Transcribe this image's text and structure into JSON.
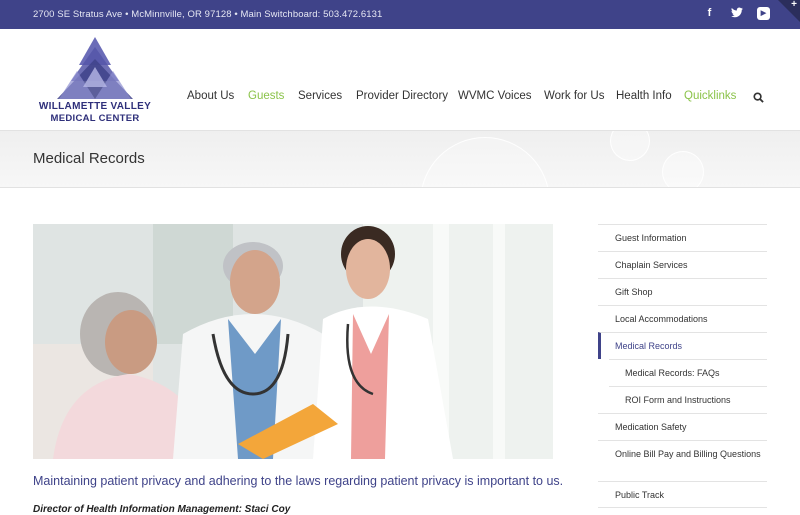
{
  "topbar": {
    "address": "2700 SE Stratus Ave • McMinnville, OR 97128 • Main Switchboard: 503.472.6131",
    "social": [
      "facebook-icon",
      "twitter-icon",
      "youtube-icon"
    ]
  },
  "logo": {
    "line1": "WILLAMETTE VALLEY",
    "line2": "MEDICAL CENTER"
  },
  "nav": {
    "items": [
      "About Us",
      "Guests",
      "Services",
      "Provider Directory",
      "WVMC Voices",
      "Work for Us",
      "Health Info",
      "Quicklinks"
    ]
  },
  "page": {
    "title": "Medical Records",
    "intro": "Maintaining patient privacy and adhering to the laws regarding patient privacy is important to us.",
    "director": "Director of Health Information Management: Staci Coy"
  },
  "sidebar": {
    "items": [
      "Guest Information",
      "Chaplain Services",
      "Gift Shop",
      "Local Accommodations",
      "Medical Records",
      "Medical Records: FAQs",
      "ROI Form and Instructions",
      "Medication Safety",
      "Online Bill Pay and Billing Questions",
      "Public Track"
    ]
  },
  "colors": {
    "brand": "#3f4389",
    "accent_green": "#8bc34a"
  }
}
